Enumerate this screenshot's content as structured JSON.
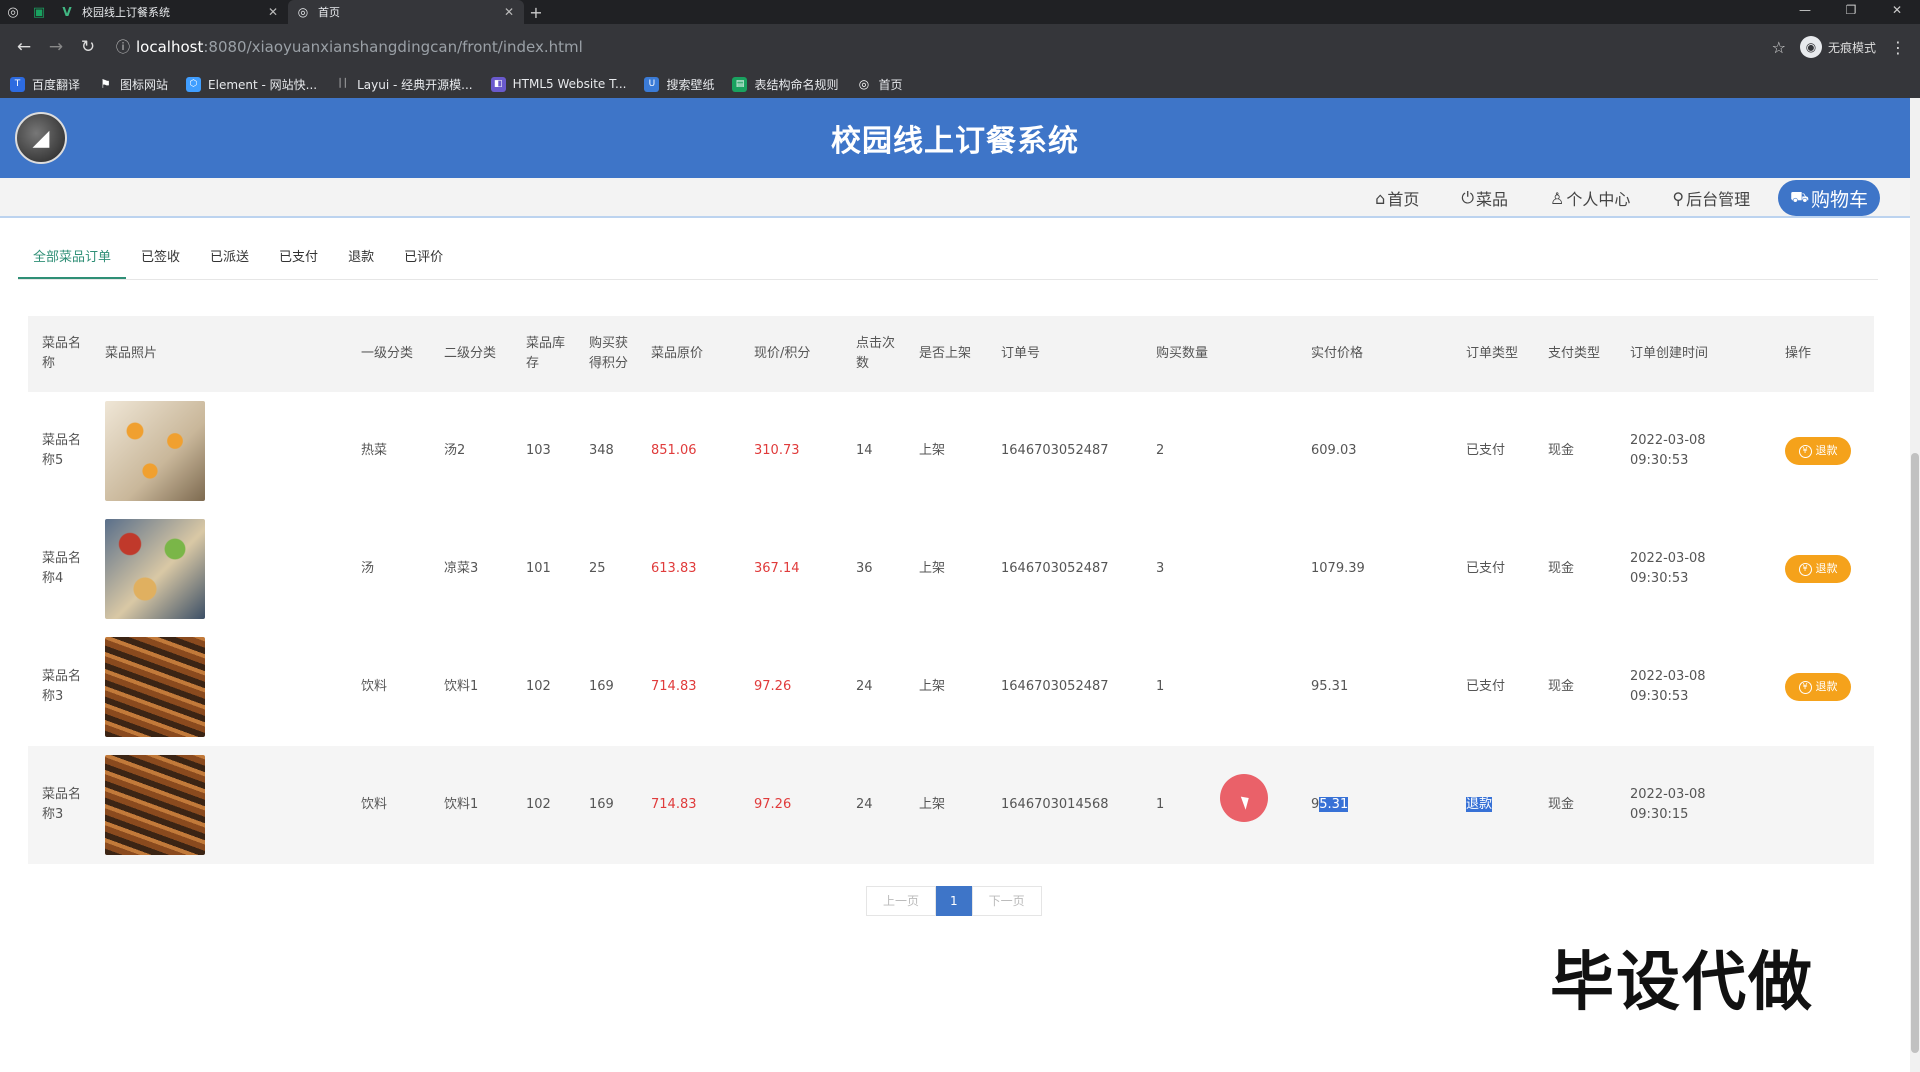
{
  "browser": {
    "tabs": [
      {
        "title": "校园线上订餐系统",
        "glyph": "V"
      },
      {
        "title": "首页",
        "glyph": "◎"
      }
    ],
    "new_tab": "+",
    "url_host": "localhost",
    "url_path": ":8080/xiaoyuanxianshangdingcan/front/index.html",
    "incognito_label": "无痕模式",
    "bookmarks": [
      {
        "label": "百度翻译",
        "color": "#2d6be0"
      },
      {
        "label": "图标网站",
        "color": "#555555"
      },
      {
        "label": "Element - 网站快...",
        "color": "#409eff"
      },
      {
        "label": "Layui - 经典开源模...",
        "color": "#444444"
      },
      {
        "label": "HTML5 Website T...",
        "color": "#6a5acd"
      },
      {
        "label": "搜索壁纸",
        "color": "#3b7bd6"
      },
      {
        "label": "表结构命名规则",
        "color": "#1aa260"
      },
      {
        "label": "首页",
        "color": "#777777"
      }
    ]
  },
  "header": {
    "title": "校园线上订餐系统"
  },
  "menu": {
    "home": "首页",
    "dishes": "菜品",
    "profile": "个人中心",
    "admin": "后台管理",
    "cart": "购物车"
  },
  "order_tabs": [
    "全部菜品订单",
    "已签收",
    "已派送",
    "已支付",
    "退款",
    "已评价"
  ],
  "table": {
    "headers": [
      "菜品名称",
      "菜品照片",
      "一级分类",
      "二级分类",
      "菜品库存",
      "购买获得积分",
      "菜品原价",
      "现价/积分",
      "点击次数",
      "是否上架",
      "订单号",
      "购买数量",
      "实付价格",
      "订单类型",
      "支付类型",
      "订单创建时间",
      "操作"
    ],
    "rows": [
      {
        "name": "菜品名称5",
        "cat1": "热菜",
        "cat2": "汤2",
        "stock": "103",
        "points": "348",
        "orig": "851.06",
        "now": "310.73",
        "clicks": "14",
        "shelf": "上架",
        "order_no": "1646703052487",
        "qty": "2",
        "paid": "609.03",
        "type": "已支付",
        "pay": "现金",
        "date": "2022-03-08",
        "time": "09:30:53",
        "action": "退款"
      },
      {
        "name": "菜品名称4",
        "cat1": "汤",
        "cat2": "凉菜3",
        "stock": "101",
        "points": "25",
        "orig": "613.83",
        "now": "367.14",
        "clicks": "36",
        "shelf": "上架",
        "order_no": "1646703052487",
        "qty": "3",
        "paid": "1079.39",
        "type": "已支付",
        "pay": "现金",
        "date": "2022-03-08",
        "time": "09:30:53",
        "action": "退款"
      },
      {
        "name": "菜品名称3",
        "cat1": "饮料",
        "cat2": "饮料1",
        "stock": "102",
        "points": "169",
        "orig": "714.83",
        "now": "97.26",
        "clicks": "24",
        "shelf": "上架",
        "order_no": "1646703052487",
        "qty": "1",
        "paid": "95.31",
        "type": "已支付",
        "pay": "现金",
        "date": "2022-03-08",
        "time": "09:30:53",
        "action": "退款"
      },
      {
        "name": "菜品名称3",
        "cat1": "饮料",
        "cat2": "饮料1",
        "stock": "102",
        "points": "169",
        "orig": "714.83",
        "now": "97.26",
        "clicks": "24",
        "shelf": "上架",
        "order_no": "1646703014568",
        "qty": "1",
        "paid_a": "9",
        "paid_b": "5.31",
        "type": "退款",
        "pay": "现金",
        "date": "2022-03-08",
        "time": "09:30:15"
      }
    ]
  },
  "pager": {
    "prev": "上一页",
    "current": "1",
    "next": "下一页"
  },
  "watermark": "毕设代做",
  "colors": {
    "primary": "#3e75c8",
    "accent_green": "#2f8f76",
    "price_red": "#e03b3b",
    "refund_orange": "#f5a21b"
  }
}
